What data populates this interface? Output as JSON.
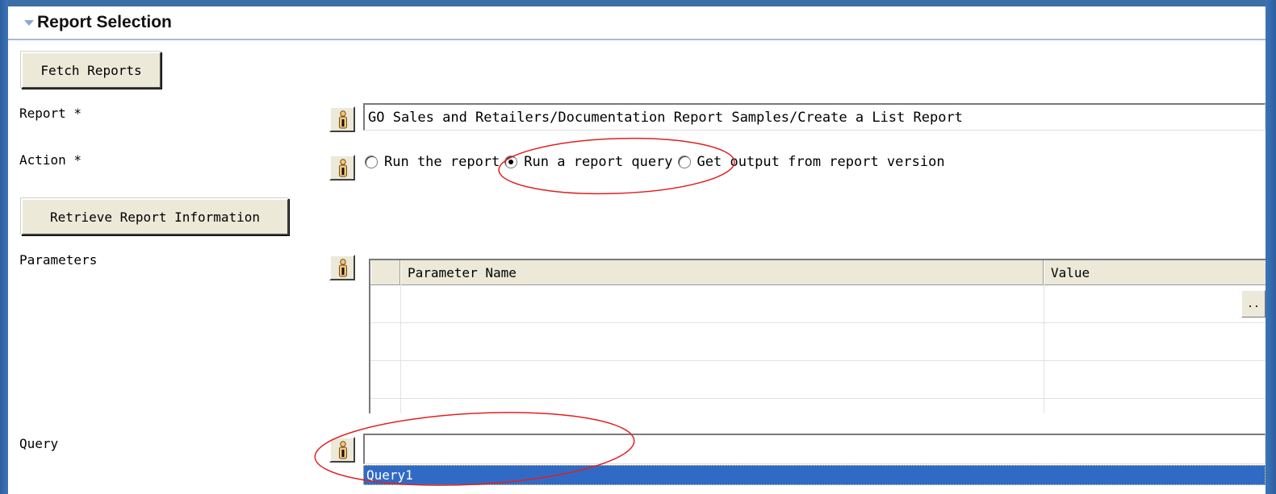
{
  "section": {
    "title": "Report Selection"
  },
  "buttons": {
    "fetch_reports": "Fetch Reports",
    "retrieve_info": "Retrieve Report Information",
    "ellipsis": ".."
  },
  "fields": {
    "report_label": "Report *",
    "report_value": "GO Sales and Retailers/Documentation Report Samples/Create a List Report",
    "action_label": "Action *",
    "parameters_label": "Parameters",
    "query_label": "Query",
    "query_value": ""
  },
  "action_options": [
    {
      "label": "Run the report",
      "checked": false
    },
    {
      "label": "Run a report query",
      "checked": true
    },
    {
      "label": "Get output from report version",
      "checked": false
    }
  ],
  "parameters_table": {
    "columns": [
      "Parameter Name",
      "Value"
    ],
    "rows": [
      {
        "name": "",
        "value": ""
      },
      {
        "name": "",
        "value": ""
      },
      {
        "name": "",
        "value": ""
      }
    ]
  },
  "query_dropdown": {
    "options": [
      "Query1"
    ],
    "selected": "Query1"
  },
  "colors": {
    "frame_blue": "#3a6ea5",
    "selection_blue": "#316ac5",
    "annotation_red": "#e02020",
    "button_face": "#ece9d8"
  }
}
